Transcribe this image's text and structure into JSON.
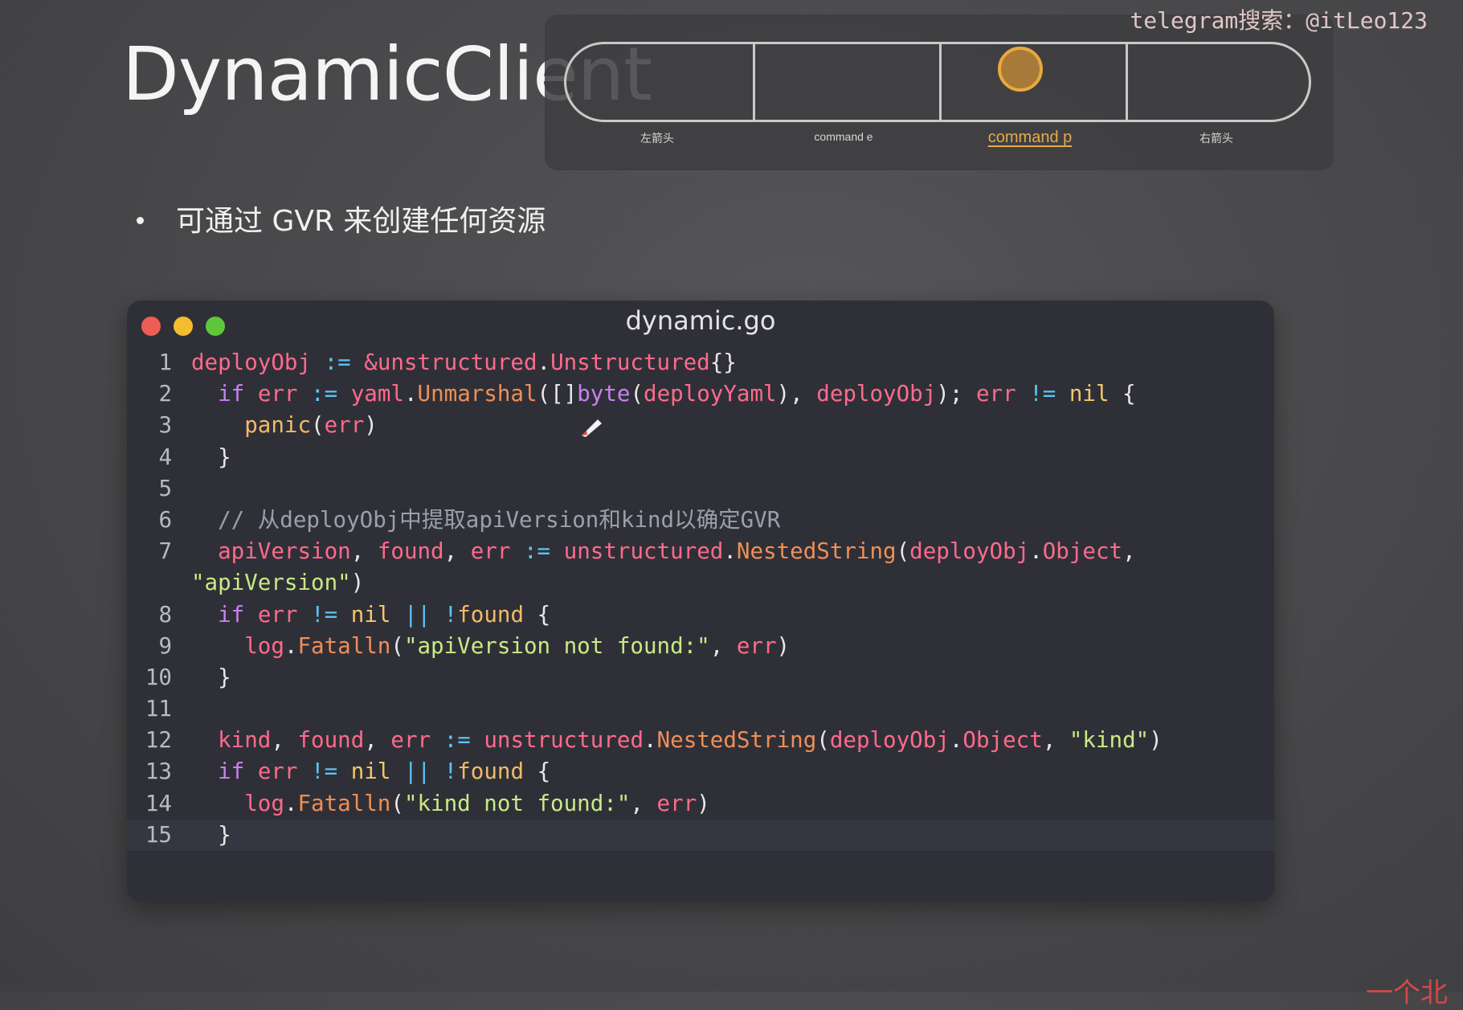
{
  "slide": {
    "title": "DynamicClient",
    "bullet": "可通过 GVR 来创建任何资源"
  },
  "watermark": "telegram搜索：@itLeo123",
  "controls": {
    "items": [
      {
        "label": "左箭头"
      },
      {
        "label": "command e"
      },
      {
        "label": "command p",
        "active": true
      },
      {
        "label": "右箭头"
      }
    ],
    "active_color": "#e6a94a"
  },
  "corner_mark": "一个北",
  "code_window": {
    "filename": "dynamic.go",
    "line_numbers": [
      "1",
      "2",
      "3",
      "4",
      "5",
      "6",
      "7",
      "",
      "8",
      "9",
      "10",
      "11",
      "12",
      "13",
      "14",
      "15"
    ],
    "highlighted_line": "15",
    "lines": [
      [
        [
          "var",
          "deployObj"
        ],
        [
          "plain",
          " "
        ],
        [
          "op",
          ":="
        ],
        [
          "plain",
          " "
        ],
        [
          "var",
          "&unstructured"
        ],
        [
          "plain",
          "."
        ],
        [
          "var",
          "Unstructured"
        ],
        [
          "plain",
          "{}"
        ]
      ],
      [
        [
          "plain",
          "  "
        ],
        [
          "kw",
          "if"
        ],
        [
          "plain",
          " "
        ],
        [
          "var",
          "err"
        ],
        [
          "plain",
          " "
        ],
        [
          "op",
          ":="
        ],
        [
          "plain",
          " "
        ],
        [
          "var",
          "yaml"
        ],
        [
          "plain",
          "."
        ],
        [
          "fn",
          "Unmarshal"
        ],
        [
          "plain",
          "([]"
        ],
        [
          "kw",
          "byte"
        ],
        [
          "plain",
          "("
        ],
        [
          "var",
          "deployYaml"
        ],
        [
          "plain",
          "), "
        ],
        [
          "var",
          "deployObj"
        ],
        [
          "plain",
          "); "
        ],
        [
          "var",
          "err"
        ],
        [
          "plain",
          " "
        ],
        [
          "op",
          "!="
        ],
        [
          "plain",
          " "
        ],
        [
          "nil",
          "nil"
        ],
        [
          "plain",
          " {"
        ]
      ],
      [
        [
          "plain",
          "    "
        ],
        [
          "call",
          "panic"
        ],
        [
          "plain",
          "("
        ],
        [
          "var",
          "err"
        ],
        [
          "plain",
          ")"
        ]
      ],
      [
        [
          "plain",
          "  }"
        ]
      ],
      [],
      [
        [
          "plain",
          "  "
        ],
        [
          "com",
          "// 从deployObj中提取apiVersion和kind以确定GVR"
        ]
      ],
      [
        [
          "plain",
          "  "
        ],
        [
          "var",
          "apiVersion"
        ],
        [
          "plain",
          ", "
        ],
        [
          "var",
          "found"
        ],
        [
          "plain",
          ", "
        ],
        [
          "var",
          "err"
        ],
        [
          "plain",
          " "
        ],
        [
          "op",
          ":="
        ],
        [
          "plain",
          " "
        ],
        [
          "var",
          "unstructured"
        ],
        [
          "plain",
          "."
        ],
        [
          "fn",
          "NestedString"
        ],
        [
          "plain",
          "("
        ],
        [
          "var",
          "deployObj"
        ],
        [
          "plain",
          "."
        ],
        [
          "var",
          "Object"
        ],
        [
          "plain",
          ","
        ]
      ],
      [
        [
          "str",
          "\"apiVersion\""
        ],
        [
          "plain",
          ")"
        ]
      ],
      [
        [
          "plain",
          "  "
        ],
        [
          "kw",
          "if"
        ],
        [
          "plain",
          " "
        ],
        [
          "var",
          "err"
        ],
        [
          "plain",
          " "
        ],
        [
          "op",
          "!="
        ],
        [
          "plain",
          " "
        ],
        [
          "nil",
          "nil"
        ],
        [
          "plain",
          " "
        ],
        [
          "op",
          "||"
        ],
        [
          "plain",
          " "
        ],
        [
          "op",
          "!"
        ],
        [
          "call",
          "found"
        ],
        [
          "plain",
          " {"
        ]
      ],
      [
        [
          "plain",
          "    "
        ],
        [
          "var",
          "log"
        ],
        [
          "plain",
          "."
        ],
        [
          "fn",
          "Fatalln"
        ],
        [
          "plain",
          "("
        ],
        [
          "str",
          "\"apiVersion not found:\""
        ],
        [
          "plain",
          ", "
        ],
        [
          "var",
          "err"
        ],
        [
          "plain",
          ")"
        ]
      ],
      [
        [
          "plain",
          "  }"
        ]
      ],
      [],
      [
        [
          "plain",
          "  "
        ],
        [
          "var",
          "kind"
        ],
        [
          "plain",
          ", "
        ],
        [
          "var",
          "found"
        ],
        [
          "plain",
          ", "
        ],
        [
          "var",
          "err"
        ],
        [
          "plain",
          " "
        ],
        [
          "op",
          ":="
        ],
        [
          "plain",
          " "
        ],
        [
          "var",
          "unstructured"
        ],
        [
          "plain",
          "."
        ],
        [
          "fn",
          "NestedString"
        ],
        [
          "plain",
          "("
        ],
        [
          "var",
          "deployObj"
        ],
        [
          "plain",
          "."
        ],
        [
          "var",
          "Object"
        ],
        [
          "plain",
          ", "
        ],
        [
          "str",
          "\"kind\""
        ],
        [
          "plain",
          ")"
        ]
      ],
      [
        [
          "plain",
          "  "
        ],
        [
          "kw",
          "if"
        ],
        [
          "plain",
          " "
        ],
        [
          "var",
          "err"
        ],
        [
          "plain",
          " "
        ],
        [
          "op",
          "!="
        ],
        [
          "plain",
          " "
        ],
        [
          "nil",
          "nil"
        ],
        [
          "plain",
          " "
        ],
        [
          "op",
          "||"
        ],
        [
          "plain",
          " "
        ],
        [
          "op",
          "!"
        ],
        [
          "call",
          "found"
        ],
        [
          "plain",
          " {"
        ]
      ],
      [
        [
          "plain",
          "    "
        ],
        [
          "var",
          "log"
        ],
        [
          "plain",
          "."
        ],
        [
          "fn",
          "Fatalln"
        ],
        [
          "plain",
          "("
        ],
        [
          "str",
          "\"kind not found:\""
        ],
        [
          "plain",
          ", "
        ],
        [
          "var",
          "err"
        ],
        [
          "plain",
          ")"
        ]
      ],
      [
        [
          "plain",
          "  }"
        ]
      ]
    ]
  }
}
